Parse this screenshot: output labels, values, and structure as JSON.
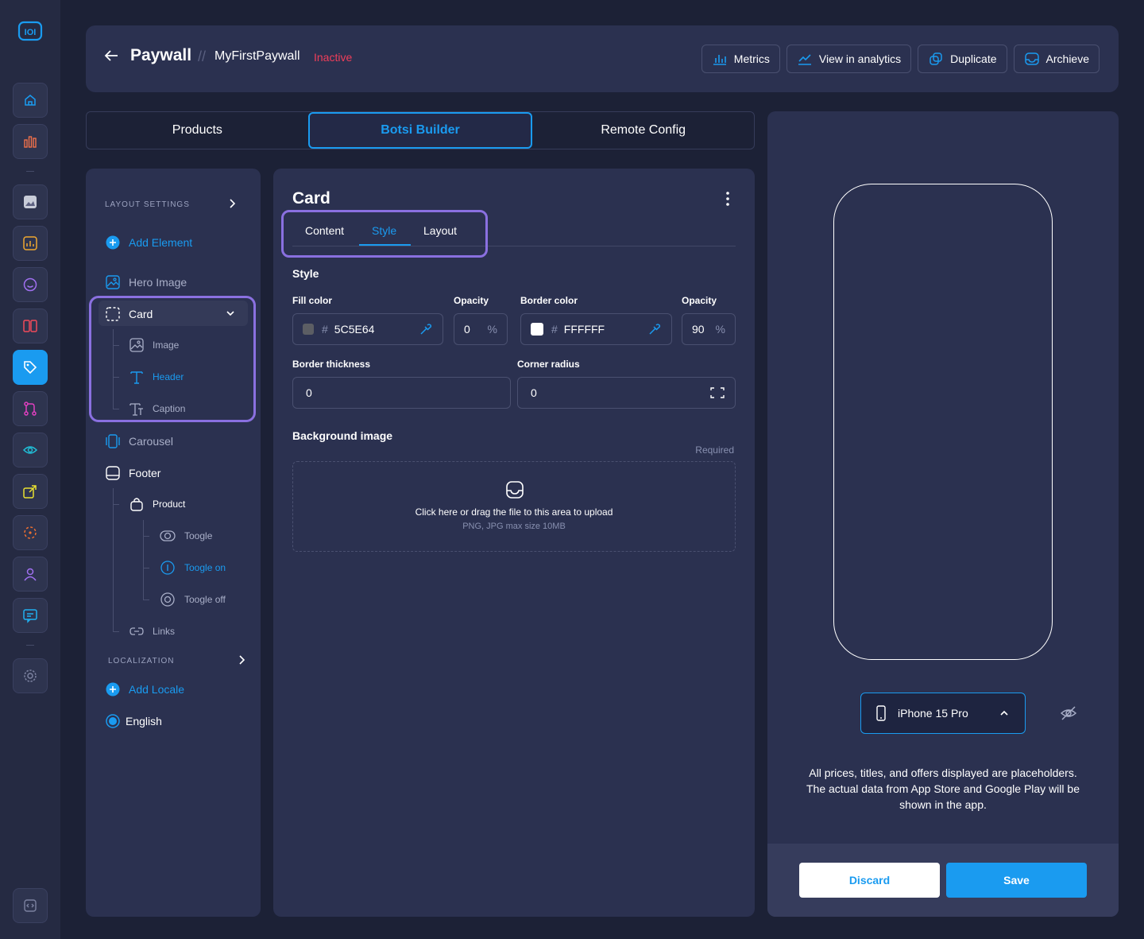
{
  "header": {
    "title": "Paywall",
    "separator": "//",
    "paywall_name": "MyFirstPaywall",
    "status": "Inactive",
    "actions": {
      "metrics": "Metrics",
      "analytics": "View in analytics",
      "duplicate": "Duplicate",
      "archive": "Archieve"
    }
  },
  "main_tabs": {
    "products": "Products",
    "builder": "Botsi Builder",
    "remote": "Remote Config"
  },
  "layers": {
    "layout_settings": "LAYOUT SETTINGS",
    "add_element": "Add Element",
    "hero_image": "Hero Image",
    "card": "Card",
    "image": "Image",
    "header": "Header",
    "caption": "Caption",
    "carousel": "Carousel",
    "footer": "Footer",
    "product": "Product",
    "toogle": "Toogle",
    "toogle_on": "Toogle on",
    "toogle_off": "Toogle off",
    "links": "Links",
    "localization": "LOCALIZATION",
    "add_locale": "Add Locale",
    "english": "English"
  },
  "editor": {
    "title": "Card",
    "tabs": {
      "content": "Content",
      "style": "Style",
      "layout": "Layout"
    },
    "section": "Style",
    "fill_color_label": "Fill color",
    "fill_color_value": "5C5E64",
    "fill_swatch": "#5c5e64",
    "opacity1_label": "Opacity",
    "opacity1_value": "0",
    "border_color_label": "Border color",
    "border_color_value": "FFFFFF",
    "border_swatch": "#ffffff",
    "opacity2_label": "Opacity",
    "opacity2_value": "90",
    "percent": "%",
    "hash": "#",
    "border_thickness_label": "Border thickness",
    "border_thickness_value": "0",
    "corner_radius_label": "Corner radius",
    "corner_radius_value": "0",
    "bg_image_label": "Background image",
    "required": "Required",
    "upload_text": "Click here or drag the file to this area to upload",
    "upload_hint": "PNG, JPG max size 10MB"
  },
  "preview": {
    "device": "iPhone 15 Pro",
    "disclaimer": "All prices, titles, and offers displayed are placeholders. The actual data from App Store and Google Play will be shown in the app.",
    "discard": "Discard",
    "save": "Save"
  },
  "colors": {
    "accent": "#1a9bf0",
    "highlight": "#8a70e0",
    "status_inactive": "#f03e5a"
  }
}
